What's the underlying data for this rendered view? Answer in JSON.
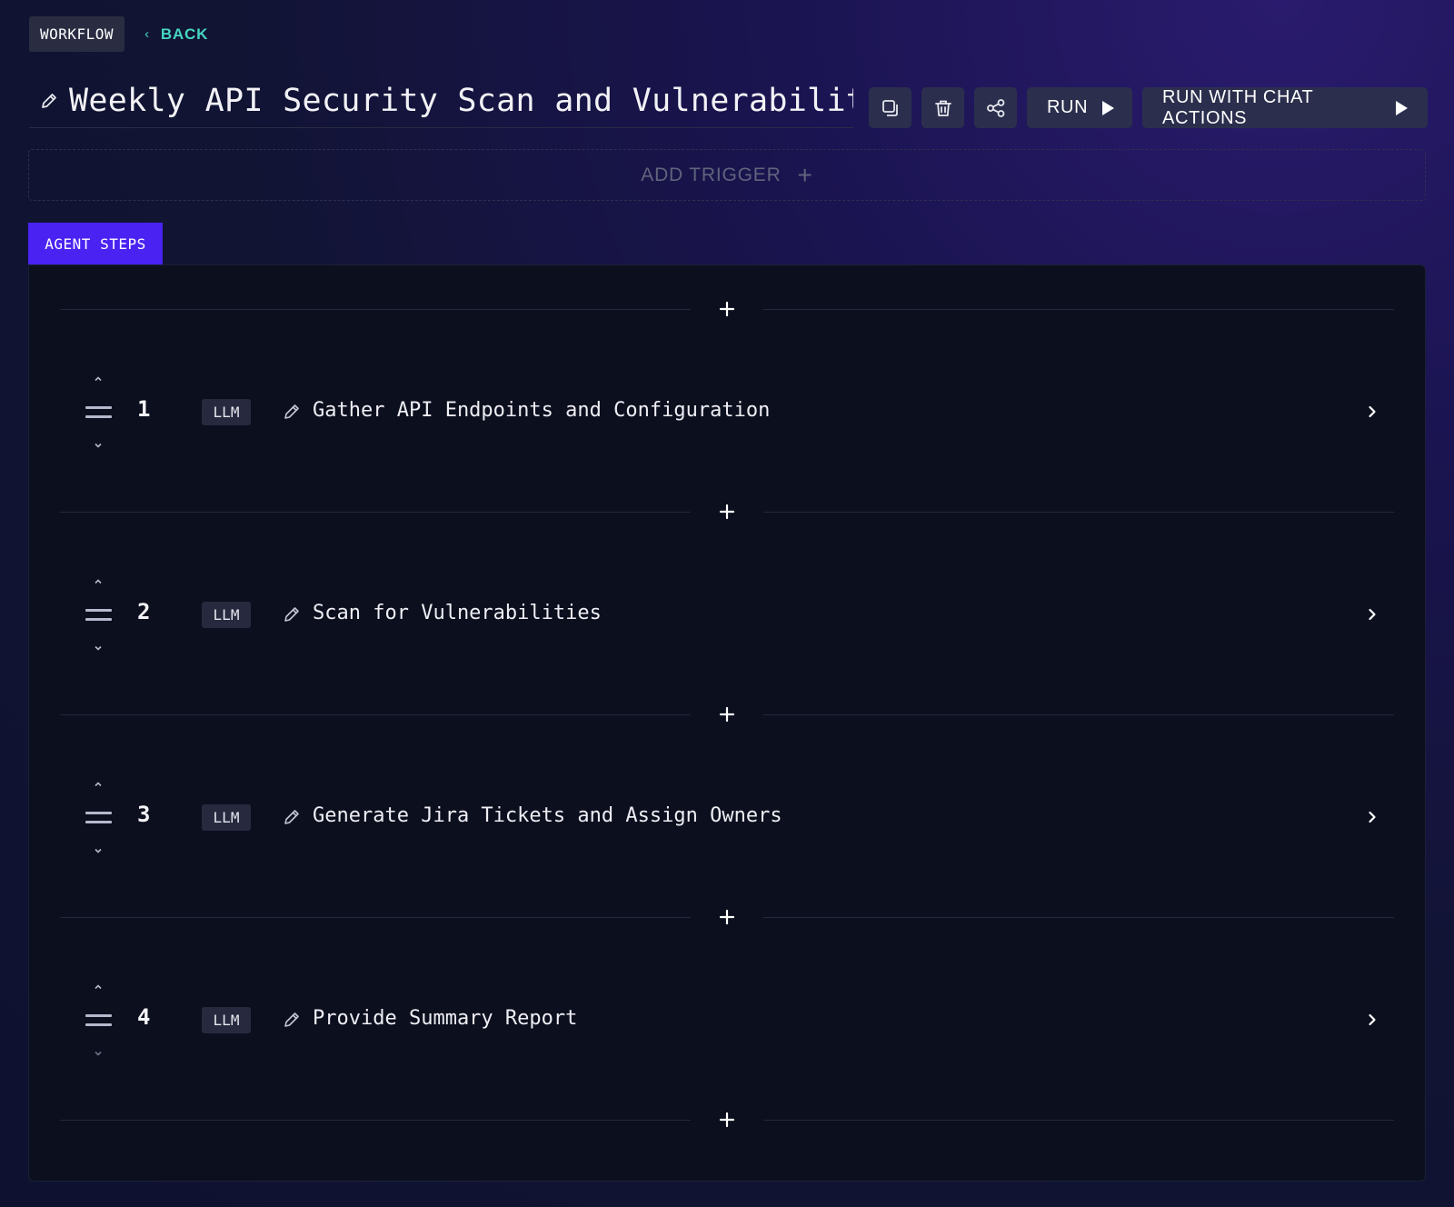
{
  "header": {
    "section_label": "WORKFLOW",
    "back_label": "BACK",
    "title": "Weekly API Security Scan and Vulnerabilit"
  },
  "actions": {
    "duplicate_icon": "copy-icon",
    "delete_icon": "trash-icon",
    "share_icon": "share-icon",
    "run_label": "RUN",
    "run_chat_label": "RUN WITH CHAT ACTIONS"
  },
  "trigger": {
    "label": "ADD TRIGGER"
  },
  "tabs": {
    "agent_steps": "AGENT STEPS"
  },
  "steps": [
    {
      "number": "1",
      "type": "LLM",
      "title": "Gather API Endpoints and Configuration"
    },
    {
      "number": "2",
      "type": "LLM",
      "title": "Scan for Vulnerabilities"
    },
    {
      "number": "3",
      "type": "LLM",
      "title": "Generate Jira Tickets and Assign Owners"
    },
    {
      "number": "4",
      "type": "LLM",
      "title": "Provide Summary Report"
    }
  ],
  "colors": {
    "accent": "#4a22f2",
    "back_link": "#45d6c0",
    "panel_bg": "#0c0f1e",
    "button_bg": "#2b2f4d"
  }
}
